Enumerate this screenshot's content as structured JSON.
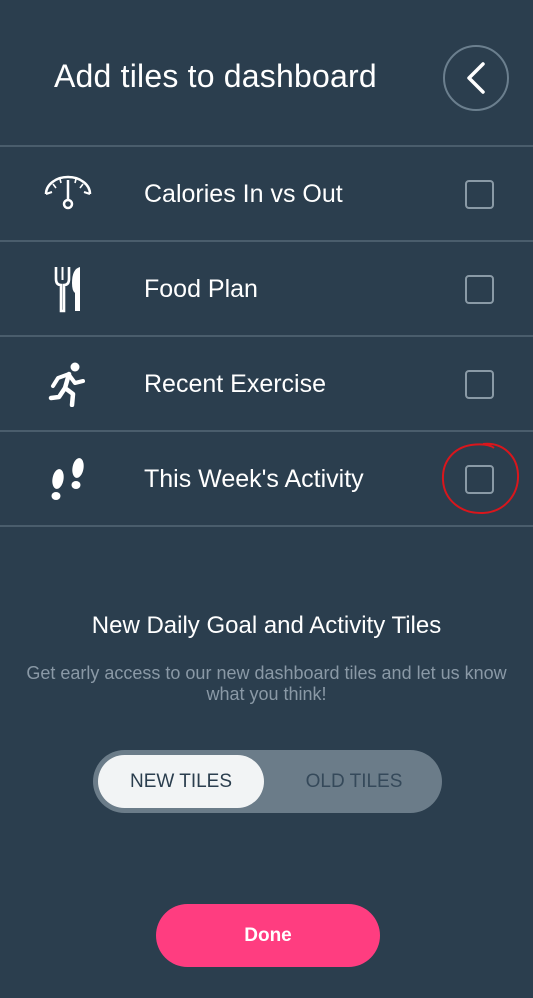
{
  "header": {
    "title": "Add tiles to dashboard",
    "back_icon": "chevron-left-icon"
  },
  "tiles": [
    {
      "label": "Calories In vs Out",
      "icon": "scale-gauge-icon",
      "checked": false
    },
    {
      "label": "Food Plan",
      "icon": "fork-knife-icon",
      "checked": false
    },
    {
      "label": "Recent Exercise",
      "icon": "running-person-icon",
      "checked": false
    },
    {
      "label": "This Week's Activity",
      "icon": "footprints-icon",
      "checked": false
    }
  ],
  "new_tiles_section": {
    "title": "New Daily Goal and Activity Tiles",
    "description": "Get early access to our new dashboard tiles and let us know what you think!"
  },
  "toggle": {
    "selected": "NEW TILES",
    "options": [
      "NEW TILES",
      "OLD TILES"
    ]
  },
  "done_label": "Done",
  "colors": {
    "background": "#2b3e4e",
    "divider": "#4a5d6c",
    "accent": "#ff3d80",
    "annotation": "#d9161c"
  }
}
